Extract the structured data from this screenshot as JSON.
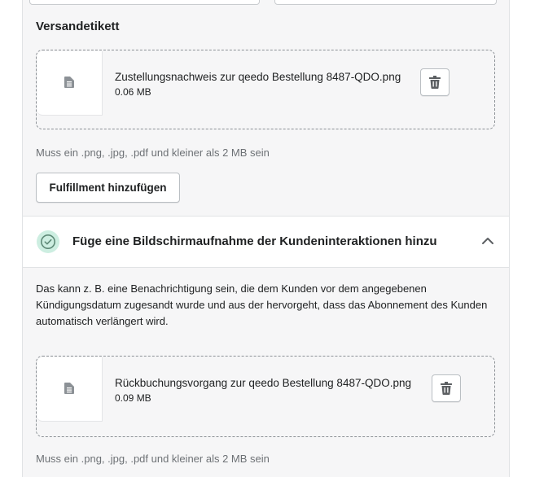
{
  "shipping_label": {
    "title": "Versandetikett",
    "file": {
      "name": "Zustellungsnachweis zur qeedo Bestellung 8487-QDO.png",
      "size": "0.06 MB"
    },
    "hint": "Muss ein .png, .jpg, .pdf und kleiner als 2 MB sein",
    "add_button": "Fulfillment hinzufügen"
  },
  "screenshot_step": {
    "title": "Füge eine Bildschirmaufnahme der Kundeninteraktionen hinzu",
    "description": "Das kann z. B. eine Benachrichtigung sein, die dem Kunden vor dem angegebenen Kündigungsdatum zugesandt wurde und aus der hervorgeht, dass das Abonnement des Kunden automatisch verlängert wird.",
    "file": {
      "name": "Rückbuchungsvorgang zur qeedo Bestellung 8487-QDO.png",
      "size": "0.09 MB"
    },
    "hint": "Muss ein .png, .jpg, .pdf und kleiner als 2 MB sein"
  },
  "colors": {
    "panel_bg": "#f6f6f7",
    "success_circle": "#cdeee1",
    "success_check": "#5f8a78"
  },
  "icons": [
    "file-icon",
    "trash-icon",
    "check-circle-icon",
    "chevron-up-icon"
  ]
}
